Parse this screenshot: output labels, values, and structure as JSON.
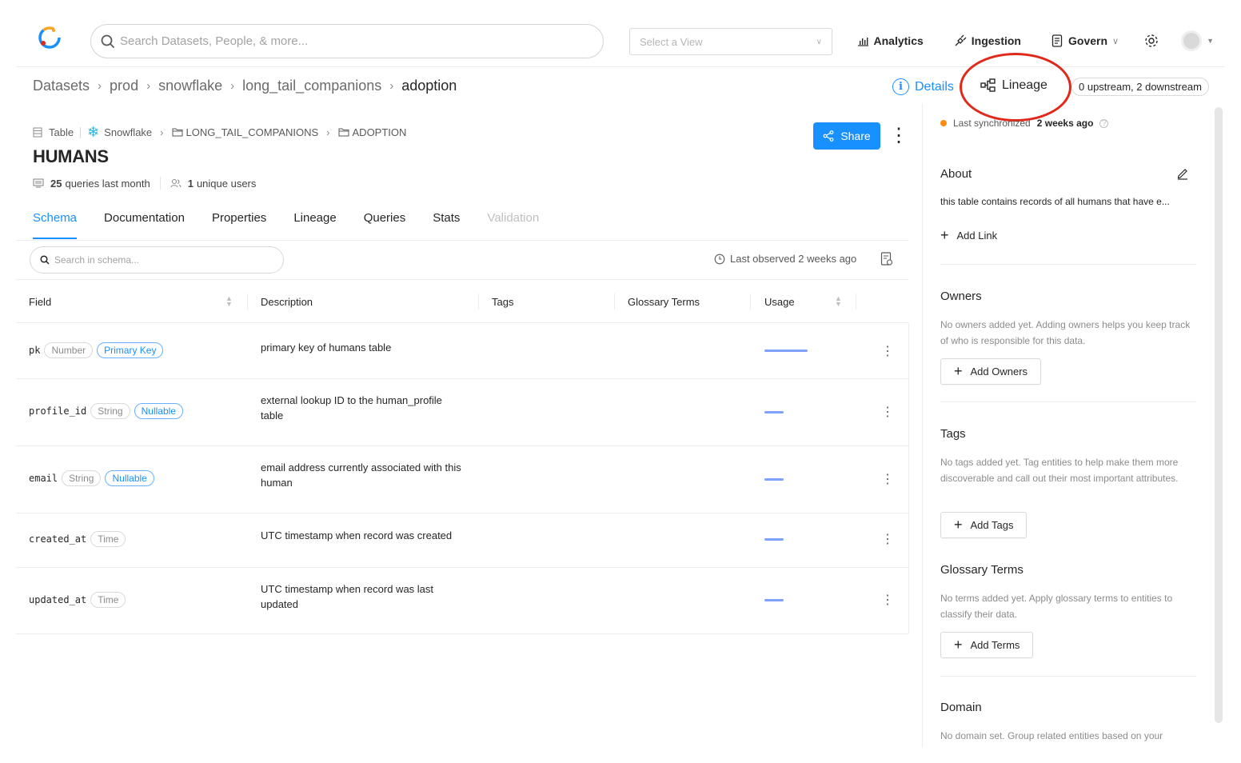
{
  "nav": {
    "search_placeholder": "Search Datasets, People, & more...",
    "view_placeholder": "Select a View",
    "links": [
      "Analytics",
      "Ingestion",
      "Govern"
    ]
  },
  "breadcrumb": {
    "items": [
      "Datasets",
      "prod",
      "snowflake",
      "long_tail_companions"
    ],
    "current": "adoption",
    "details_label": "Details",
    "lineage_label": "Lineage",
    "lineage_counts": "0 upstream, 2 downstream"
  },
  "entity": {
    "type": "Table",
    "platform": "Snowflake",
    "container": "LONG_TAIL_COMPANIONS",
    "schema": "ADOPTION",
    "title": "HUMANS",
    "queries_count": "25",
    "queries_label": "queries last month",
    "users_count": "1",
    "users_label": "unique users",
    "share_label": "Share"
  },
  "tabs": [
    "Schema",
    "Documentation",
    "Properties",
    "Lineage",
    "Queries",
    "Stats",
    "Validation"
  ],
  "schema": {
    "search_placeholder": "Search in schema...",
    "last_observed": "Last observed 2 weeks ago",
    "columns": [
      "Field",
      "Description",
      "Tags",
      "Glossary Terms",
      "Usage"
    ],
    "rows": [
      {
        "field": "pk",
        "type": "Number",
        "tag": "Primary Key",
        "description": "primary key of humans table",
        "usage": 1.0
      },
      {
        "field": "profile_id",
        "type": "String",
        "tag": "Nullable",
        "description": "external lookup ID to the human_profile table",
        "usage": 0.45
      },
      {
        "field": "email",
        "type": "String",
        "tag": "Nullable",
        "description": "email address currently associated with this human",
        "usage": 0.45
      },
      {
        "field": "created_at",
        "type": "Time",
        "tag": "",
        "description": "UTC timestamp when record was created",
        "usage": 0.45
      },
      {
        "field": "updated_at",
        "type": "Time",
        "tag": "",
        "description": "UTC timestamp when record was last updated",
        "usage": 0.45
      }
    ]
  },
  "sidebar": {
    "sync_prefix": "Last synchronized",
    "sync_time": "2 weeks ago",
    "about_title": "About",
    "about_text": "this table contains records of all humans that have e...",
    "add_link": "Add Link",
    "owners_title": "Owners",
    "owners_text": "No owners added yet. Adding owners helps you keep track of who is responsible for this data.",
    "add_owners": "Add Owners",
    "tags_title": "Tags",
    "tags_text": "No tags added yet. Tag entities to help make them more discoverable and call out their most important attributes.",
    "add_tags": "Add Tags",
    "glossary_title": "Glossary Terms",
    "glossary_text": "No terms added yet. Apply glossary terms to entities to classify their data.",
    "add_terms": "Add Terms",
    "domain_title": "Domain",
    "domain_text": "No domain set. Group related entities based on your"
  },
  "colors": {
    "accent": "#1890ff",
    "highlight": "#e0291b",
    "usage_bar": "#7ea1ff",
    "sync_dot": "#fa8c16"
  }
}
